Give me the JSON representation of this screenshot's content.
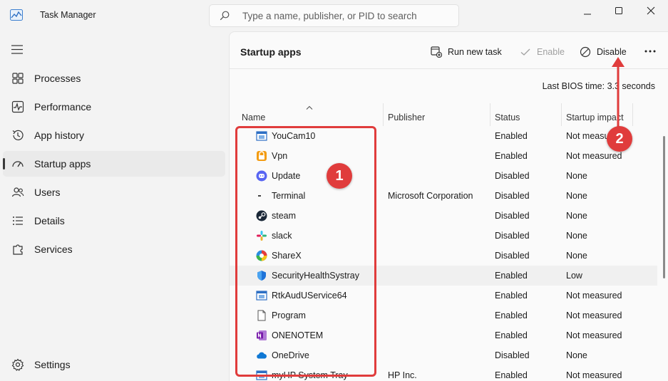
{
  "titlebar": {
    "title": "Task Manager",
    "search_placeholder": "Type a name, publisher, or PID to search"
  },
  "sidebar": {
    "items": [
      {
        "label": "Processes",
        "icon": "processes-grid-icon"
      },
      {
        "label": "Performance",
        "icon": "performance-pulse-icon"
      },
      {
        "label": "App history",
        "icon": "history-clock-icon"
      },
      {
        "label": "Startup apps",
        "icon": "startup-speedometer-icon",
        "active": true
      },
      {
        "label": "Users",
        "icon": "users-icon"
      },
      {
        "label": "Details",
        "icon": "details-list-icon"
      },
      {
        "label": "Services",
        "icon": "services-puzzle-icon"
      }
    ],
    "settings_label": "Settings"
  },
  "toolbar": {
    "page_title": "Startup apps",
    "run_new_task": "Run new task",
    "enable": "Enable",
    "disable": "Disable"
  },
  "bios": "Last BIOS time:  3.3 seconds",
  "table": {
    "headers": {
      "name": "Name",
      "publisher": "Publisher",
      "status": "Status",
      "impact": "Startup impact"
    },
    "rows": [
      {
        "name": "YouCam10",
        "publisher": "",
        "status": "Enabled",
        "impact": "Not measured",
        "icon": "window-app-icon"
      },
      {
        "name": "Vpn",
        "publisher": "",
        "status": "Enabled",
        "impact": "Not measured",
        "icon": "vpn-icon"
      },
      {
        "name": "Update",
        "publisher": "",
        "status": "Disabled",
        "impact": "None",
        "icon": "discord-icon"
      },
      {
        "name": "Terminal",
        "publisher": "Microsoft Corporation",
        "status": "Disabled",
        "impact": "None",
        "icon": "terminal-icon"
      },
      {
        "name": "steam",
        "publisher": "",
        "status": "Disabled",
        "impact": "None",
        "icon": "steam-icon"
      },
      {
        "name": "slack",
        "publisher": "",
        "status": "Disabled",
        "impact": "None",
        "icon": "slack-icon"
      },
      {
        "name": "ShareX",
        "publisher": "",
        "status": "Disabled",
        "impact": "None",
        "icon": "sharex-icon"
      },
      {
        "name": "SecurityHealthSystray",
        "publisher": "",
        "status": "Enabled",
        "impact": "Low",
        "icon": "shield-icon",
        "highlight": true
      },
      {
        "name": "RtkAudUService64",
        "publisher": "",
        "status": "Enabled",
        "impact": "Not measured",
        "icon": "window-app-icon"
      },
      {
        "name": "Program",
        "publisher": "",
        "status": "Enabled",
        "impact": "Not measured",
        "icon": "blank-file-icon"
      },
      {
        "name": "ONENOTEM",
        "publisher": "",
        "status": "Enabled",
        "impact": "Not measured",
        "icon": "onenote-icon"
      },
      {
        "name": "OneDrive",
        "publisher": "",
        "status": "Disabled",
        "impact": "None",
        "icon": "onedrive-cloud-icon"
      },
      {
        "name": "myHP System Tray",
        "publisher": "HP Inc.",
        "status": "Enabled",
        "impact": "Not measured",
        "icon": "window-app-icon"
      }
    ]
  },
  "annotations": {
    "badge1": "1",
    "badge2": "2",
    "color": "#e03c3c"
  }
}
